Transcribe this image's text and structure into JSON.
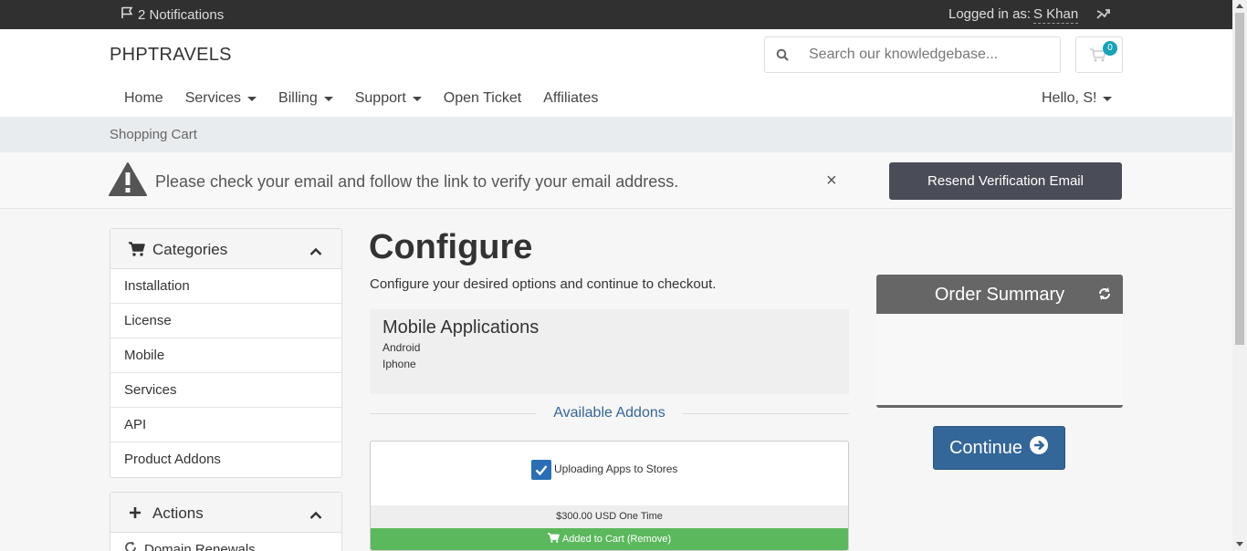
{
  "topbar": {
    "notifications": "2 Notifications",
    "logged_in_label": "Logged in as:",
    "user": "S Khan"
  },
  "header": {
    "brand": "PHPTRAVELS",
    "search_placeholder": "Search our knowledgebase...",
    "cart_count": "0",
    "nav": [
      "Home",
      "Services",
      "Billing",
      "Support",
      "Open Ticket",
      "Affiliates"
    ],
    "hello": "Hello, S!"
  },
  "breadcrumb": "Shopping Cart",
  "alert": {
    "message": "Please check your email and follow the link to verify your email address.",
    "close": "×",
    "button": "Resend Verification Email"
  },
  "sidebar": {
    "categories": {
      "title": "Categories",
      "items": [
        "Installation",
        "License",
        "Mobile",
        "Services",
        "API",
        "Product Addons"
      ]
    },
    "actions": {
      "title": "Actions",
      "items": [
        "Domain Renewals"
      ]
    }
  },
  "main": {
    "title": "Configure",
    "subtitle": "Configure your desired options and continue to checkout.",
    "product": {
      "name": "Mobile Applications",
      "lines": [
        "Android",
        "Iphone"
      ]
    },
    "addons_heading": "Available Addons",
    "addon": {
      "name": "Uploading Apps to Stores",
      "checked": true,
      "price": "$300.00 USD One Time",
      "status": "Added to Cart (Remove)"
    }
  },
  "summary": {
    "title": "Order Summary",
    "continue": "Continue"
  },
  "colors": {
    "topbar": "#303030",
    "accent": "#336699",
    "success": "#5cb85c",
    "resend_button": "#4a4d57",
    "summary_header": "#666666",
    "badge": "#17a2b8"
  },
  "icons": [
    "flag-icon",
    "share-icon",
    "search-icon",
    "cart-icon",
    "warning-icon",
    "close-icon",
    "shopping-cart-icon",
    "chevron-up-icon",
    "plus-icon",
    "refresh-icon",
    "arrow-circle-right-icon",
    "check-icon"
  ]
}
